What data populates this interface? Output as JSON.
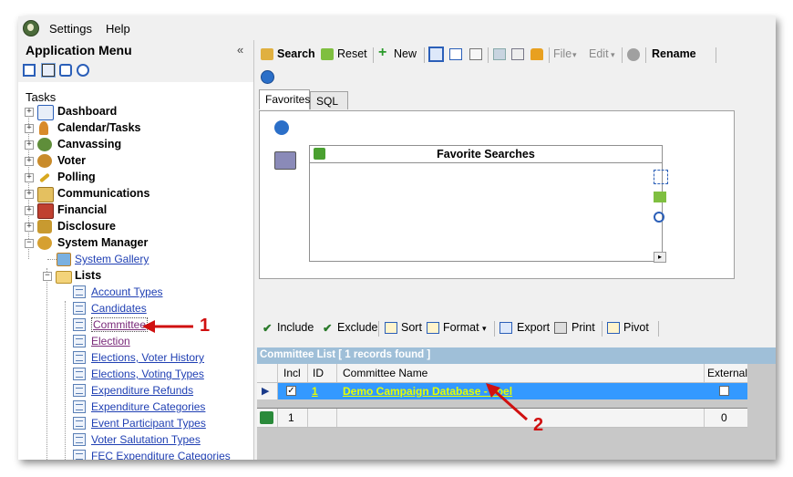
{
  "menubar": {
    "items": [
      "Settings",
      "Help"
    ]
  },
  "app_menu": {
    "title": "Application Menu",
    "collapse": "«",
    "tasks_label": "Tasks"
  },
  "tree": {
    "top_items": [
      "Dashboard",
      "Calendar/Tasks",
      "Canvassing",
      "Voter",
      "Polling",
      "Communications",
      "Financial",
      "Disclosure",
      "System Manager"
    ],
    "system_gallery": "System Gallery",
    "lists": "Lists",
    "list_items": [
      "Account Types",
      "Candidates",
      "Committee",
      "Election",
      "Elections, Voter History",
      "Elections, Voting Types",
      "Expenditure Refunds",
      "Expenditure Categories",
      "Event Participant Types",
      "Voter Salutation Types",
      "FEC Expenditure Categories"
    ]
  },
  "toolbar": {
    "search": "Search",
    "reset": "Reset",
    "new": "New",
    "file": "File",
    "edit": "Edit",
    "rename": "Rename",
    "dropdown_glyph": "▾"
  },
  "tabs": [
    "Favorites",
    "SQL"
  ],
  "favorites": {
    "title": "Favorite Searches"
  },
  "grid_toolbar": {
    "include": "Include",
    "exclude": "Exclude",
    "sort": "Sort",
    "format": "Format",
    "export": "Export",
    "print": "Print",
    "pivot": "Pivot",
    "dropdown_glyph": "▾"
  },
  "list_bar": "Committee List [ 1 records found ]",
  "grid": {
    "columns": [
      "Incl",
      "ID",
      "Committee Name",
      "External"
    ],
    "row": {
      "id": "1",
      "name": "Demo Campaign Database - Joel",
      "incl": true,
      "external": false
    },
    "footer": {
      "count": "1",
      "external_total": "0"
    }
  },
  "annotations": [
    "1",
    "2"
  ],
  "colors": {
    "selection": "#3399ff",
    "annotation": "#d01010",
    "list_bar": "#9fbfd8",
    "link": "#1f3fb3",
    "row_link": "#e6ff00"
  }
}
